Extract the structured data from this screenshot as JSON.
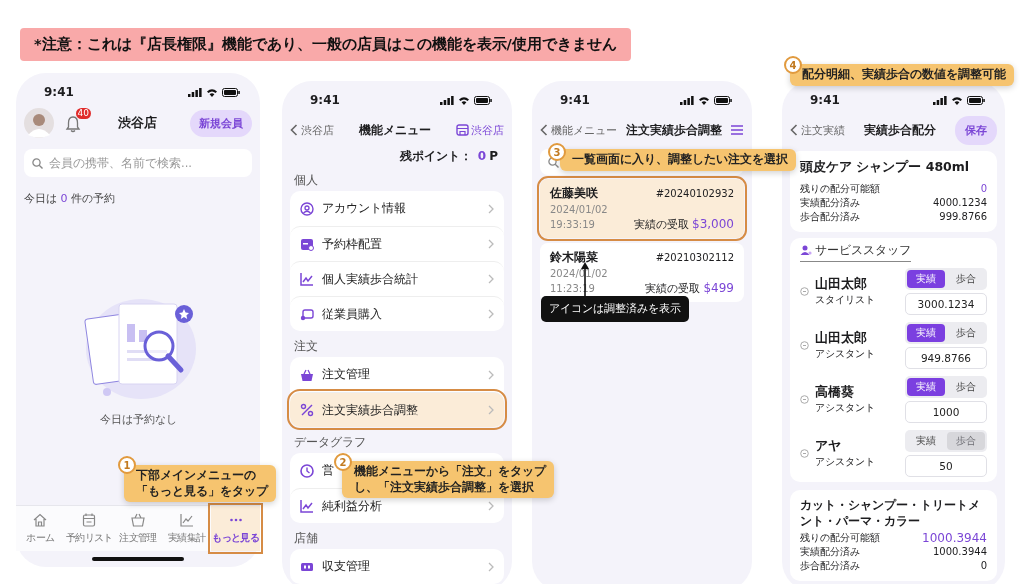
{
  "notice": "*注意：これは『店長権限』機能であり、一般の店員はこの機能を表示/使用できません",
  "screens": [
    {
      "kind": "home",
      "time": "9:41",
      "notification_count": "40",
      "store": "渋谷店",
      "new_member_button": "新規会員",
      "search": {
        "placeholder": "会員の携帯、名前で検索..."
      },
      "today": {
        "before": "今日は",
        "count": "0",
        "after": "件の予約"
      },
      "empty_message": "今日は予約なし",
      "tabs": [
        {
          "label": "ホーム",
          "selected": false,
          "highlighted": false
        },
        {
          "label": "予約リスト",
          "selected": false,
          "highlighted": false
        },
        {
          "label": "注文管理",
          "selected": false,
          "highlighted": false
        },
        {
          "label": "実績集計",
          "selected": false,
          "highlighted": false
        },
        {
          "label": "もっと見る",
          "selected": true,
          "highlighted": true
        }
      ],
      "callout": {
        "step": "1",
        "lines": [
          "下部メインメニューの",
          "「もっと見る」をタップ"
        ]
      }
    },
    {
      "kind": "menu",
      "time": "9:41",
      "back": "渋谷店",
      "title": "機能メニュー",
      "store_link": "渋谷店",
      "points": {
        "label": "残ポイント：",
        "value": "0",
        "unit": "P"
      },
      "sections": [
        {
          "label": "個人",
          "items": [
            {
              "label": "アカウント情報",
              "highlighted": false
            },
            {
              "label": "予約枠配置",
              "highlighted": false
            },
            {
              "label": "個人実績歩合統計",
              "highlighted": false
            },
            {
              "label": "従業員購入",
              "highlighted": false
            }
          ]
        },
        {
          "label": "注文",
          "items": [
            {
              "label": "注文管理",
              "highlighted": false
            },
            {
              "label": "注文実績歩合調整",
              "highlighted": true
            }
          ]
        },
        {
          "label": "データグラフ",
          "items": [
            {
              "label": "営",
              "highlighted": false
            },
            {
              "label": "純利益分析",
              "highlighted": false
            }
          ]
        },
        {
          "label": "店舗",
          "items": [
            {
              "label": "収支管理",
              "highlighted": false
            }
          ]
        }
      ],
      "callout": {
        "step": "2",
        "lines": [
          "機能メニューから「注文」をタップ",
          "し、「注文実績歩合調整」を選択"
        ]
      }
    },
    {
      "kind": "orders",
      "time": "9:41",
      "back": "機能メニュー",
      "title": "注文実績歩合調整",
      "orders": [
        {
          "customer": "佐藤美咲",
          "number": "#20240102932",
          "date": "2024/01/02",
          "time": "19:33:19",
          "amount_label": "実績の受取",
          "amount": "$3,000",
          "highlighted": true
        },
        {
          "customer": "鈴木陽菜",
          "number": "#20210302112",
          "date": "2024/01/02",
          "time": "11:23:19",
          "amount_label": "実績の受取",
          "amount": "$499",
          "highlighted": false
        }
      ],
      "tooltip": "アイコンは調整済みを表示",
      "callout": {
        "step": "3",
        "lines": [
          "一覧画面に入り、調整したい注文を選択"
        ]
      }
    },
    {
      "kind": "allocation",
      "time": "9:41",
      "back": "注文実績",
      "title": "実績歩合配分",
      "save_button": "保存",
      "product": {
        "name": "頭皮ケア シャンプー 480ml",
        "rows": [
          {
            "label": "残りの配分可能額",
            "value": "0"
          },
          {
            "label": "実績配分済み",
            "value": "4000.1234"
          },
          {
            "label": "歩合配分済み",
            "value": "999.8766"
          }
        ]
      },
      "staff_title": "サービススタッフ",
      "staff": [
        {
          "name": "山田太郎",
          "role": "スタイリスト",
          "options": [
            {
              "label": "実績",
              "selected": true,
              "disabled": false
            },
            {
              "label": "歩合",
              "selected": false,
              "disabled": false
            }
          ],
          "value": "3000.1234"
        },
        {
          "name": "山田太郎",
          "role": "アシスタント",
          "options": [
            {
              "label": "実績",
              "selected": true,
              "disabled": false
            },
            {
              "label": "歩合",
              "selected": false,
              "disabled": false
            }
          ],
          "value": "949.8766"
        },
        {
          "name": "高橋葵",
          "role": "アシスタント",
          "options": [
            {
              "label": "実績",
              "selected": true,
              "disabled": false
            },
            {
              "label": "歩合",
              "selected": false,
              "disabled": false
            }
          ],
          "value": "1000"
        },
        {
          "name": "アヤ",
          "role": "アシスタント",
          "options": [
            {
              "label": "実績",
              "selected": false,
              "disabled": false
            },
            {
              "label": "歩合",
              "selected": false,
              "disabled": true
            }
          ],
          "value": "50"
        }
      ],
      "service": {
        "name": "カット・シャンプー・トリートメント・パーマ・カラー",
        "rows": [
          {
            "label": "残りの配分可能額",
            "value": "1000.3944"
          },
          {
            "label": "実績配分済み",
            "value": "1000.3944"
          },
          {
            "label": "歩合配分済み",
            "value": "0"
          }
        ]
      },
      "callout": {
        "step": "4",
        "lines": [
          "配分明細、実績歩合の数値を調整可能"
        ]
      }
    }
  ]
}
